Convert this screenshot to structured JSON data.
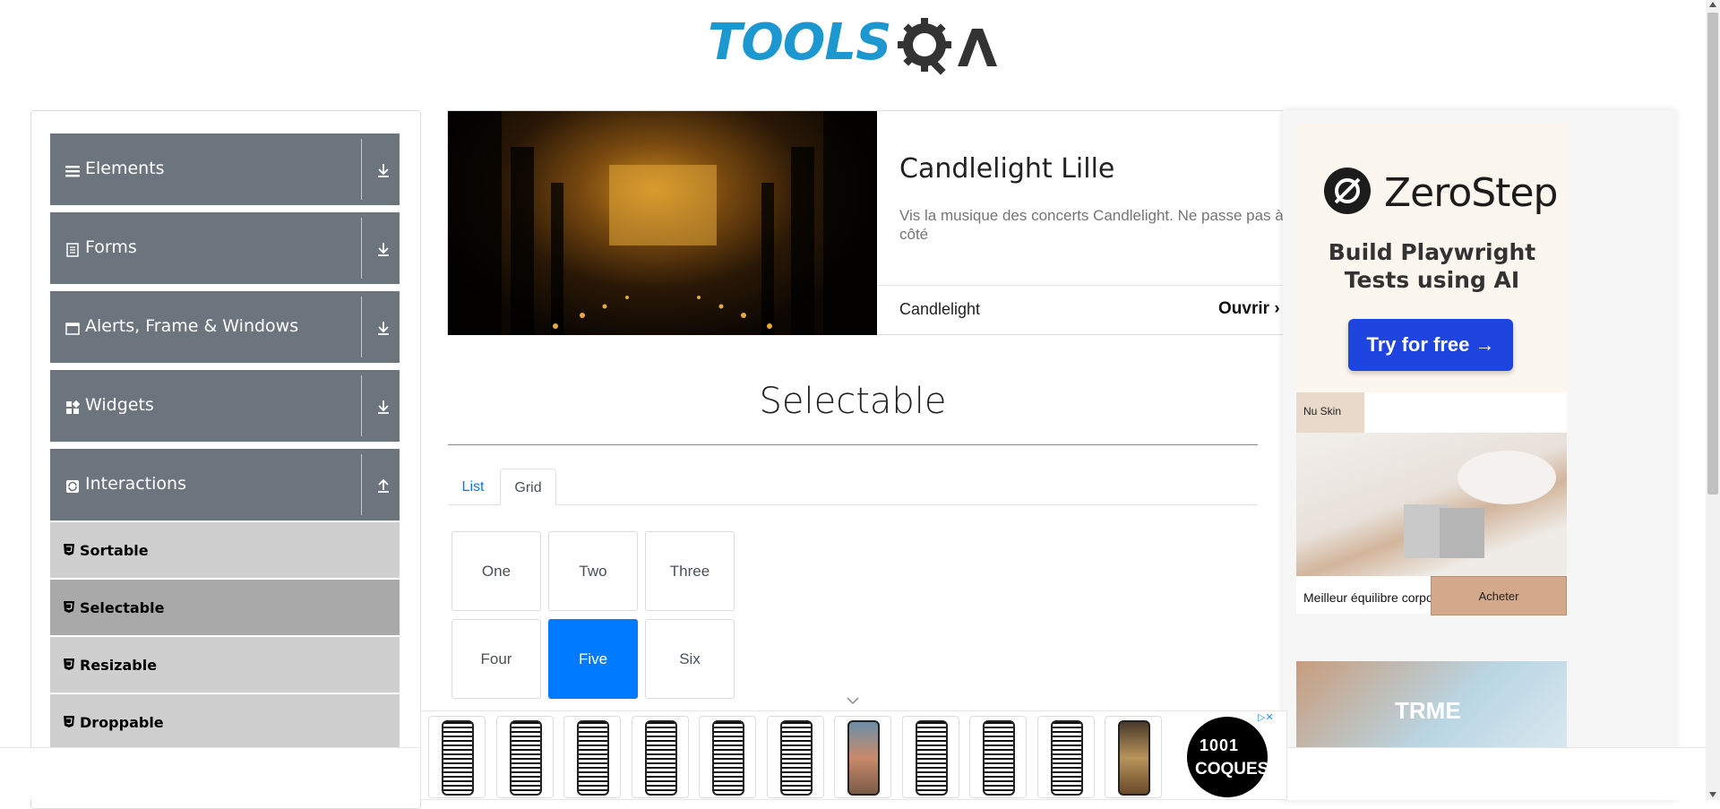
{
  "header": {
    "logo_text": "TOOLS",
    "logo_qa": "QA"
  },
  "sidebar": {
    "groups": [
      {
        "label": "Elements",
        "icon": "menu-icon",
        "expanded": false
      },
      {
        "label": "Forms",
        "icon": "form-icon",
        "expanded": false
      },
      {
        "label": "Alerts, Frame & Windows",
        "icon": "window-icon",
        "expanded": false
      },
      {
        "label": "Widgets",
        "icon": "widgets-icon",
        "expanded": false
      },
      {
        "label": "Interactions",
        "icon": "interactions-icon",
        "expanded": true
      }
    ],
    "items": [
      {
        "label": "Sortable",
        "active": false
      },
      {
        "label": "Selectable",
        "active": true
      },
      {
        "label": "Resizable",
        "active": false
      },
      {
        "label": "Droppable",
        "active": false
      }
    ]
  },
  "banner_ad": {
    "title": "Candlelight Lille",
    "description": "Vis la musique des concerts Candlelight. Ne passe pas à côté",
    "brand": "Candlelight",
    "cta": "Ouvrir"
  },
  "main": {
    "title": "Selectable",
    "tabs": [
      {
        "label": "List",
        "active": false
      },
      {
        "label": "Grid",
        "active": true
      }
    ],
    "grid": [
      {
        "label": "One",
        "active": false
      },
      {
        "label": "Two",
        "active": false
      },
      {
        "label": "Three",
        "active": false
      },
      {
        "label": "Four",
        "active": false
      },
      {
        "label": "Five",
        "active": true
      },
      {
        "label": "Six",
        "active": false
      }
    ]
  },
  "side_ad": {
    "brand": "ZeroStep",
    "tagline": "Build Playwright Tests using AI",
    "cta": "Try for free →",
    "nu_label": "Nu Skin",
    "nu_caption": "Meilleur équilibre corporel",
    "nu_button": "Acheter",
    "nu2_text": "TRME"
  },
  "bottom_ad": {
    "shop_digits": "1001",
    "shop_name": "COQUES"
  },
  "colors": {
    "accent": "#007bff",
    "sidebar_group": "#6c757d",
    "logo_blue": "#1d97d0"
  }
}
